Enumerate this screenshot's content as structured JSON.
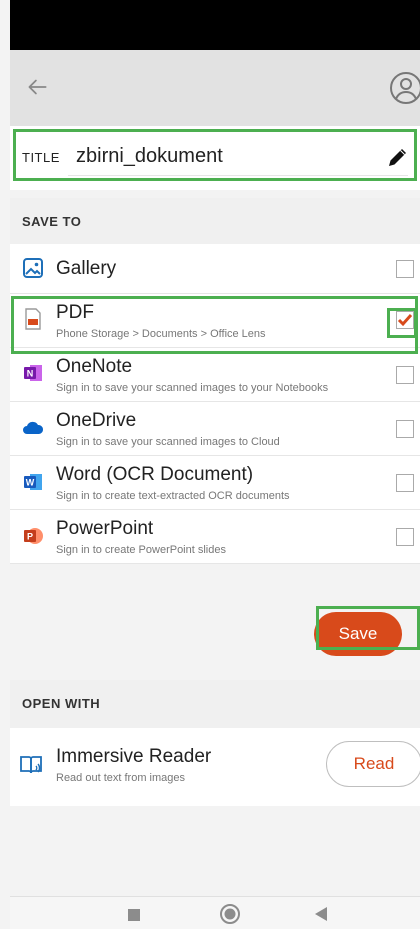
{
  "title_field": {
    "label": "TITLE",
    "value": "zbirni_dokument"
  },
  "save_to": {
    "header": "SAVE TO",
    "items": [
      {
        "name": "Gallery",
        "subtitle": "",
        "icon": "gallery-icon",
        "checked": false
      },
      {
        "name": "PDF",
        "subtitle": "Phone Storage > Documents > Office Lens",
        "icon": "pdf-icon",
        "checked": true
      },
      {
        "name": "OneNote",
        "subtitle": "Sign in to save your scanned images to your Notebooks",
        "icon": "onenote-icon",
        "checked": false
      },
      {
        "name": "OneDrive",
        "subtitle": "Sign in to save your scanned images to Cloud",
        "icon": "onedrive-icon",
        "checked": false
      },
      {
        "name": "Word (OCR Document)",
        "subtitle": "Sign in to create text-extracted OCR documents",
        "icon": "word-icon",
        "checked": false
      },
      {
        "name": "PowerPoint",
        "subtitle": "Sign in to create PowerPoint slides",
        "icon": "powerpoint-icon",
        "checked": false
      }
    ],
    "save_label": "Save"
  },
  "open_with": {
    "header": "OPEN WITH",
    "item": {
      "name": "Immersive Reader",
      "subtitle": "Read out text from images",
      "button": "Read"
    }
  },
  "colors": {
    "accent": "#d84a1b",
    "highlight": "#4caf50",
    "checkmark": "#d84a1b"
  }
}
